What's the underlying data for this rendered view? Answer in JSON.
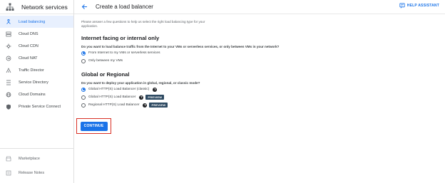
{
  "sidebar": {
    "title": "Network services",
    "items": [
      {
        "label": "Load balancing",
        "icon": "load-balancing-icon",
        "active": true
      },
      {
        "label": "Cloud DNS",
        "icon": "dns-icon"
      },
      {
        "label": "Cloud CDN",
        "icon": "cdn-icon"
      },
      {
        "label": "Cloud NAT",
        "icon": "nat-icon"
      },
      {
        "label": "Traffic Director",
        "icon": "traffic-director-icon"
      },
      {
        "label": "Service Directory",
        "icon": "service-directory-icon"
      },
      {
        "label": "Cloud Domains",
        "icon": "domains-icon"
      },
      {
        "label": "Private Service Connect",
        "icon": "shield-icon"
      }
    ],
    "bottom_items": [
      {
        "label": "Marketplace",
        "icon": "marketplace-icon"
      },
      {
        "label": "Release Notes",
        "icon": "release-notes-icon"
      }
    ]
  },
  "header": {
    "title": "Create a load balancer",
    "help_label": "HELP ASSISTANT"
  },
  "main": {
    "intro": "Please answer a few questions to help us select the right load balancing type for your application.",
    "section1": {
      "title": "Internet facing or internal only",
      "question": "Do you want to load balance traffic from the Internet to your VMs or serverless services, or only between VMs in your network?",
      "options": [
        {
          "label": "From Internet to my VMs or serverless services",
          "checked": true
        },
        {
          "label": "Only between my VMs",
          "checked": false
        }
      ]
    },
    "section2": {
      "title": "Global or Regional",
      "question": "Do you want to deploy your application in global, regional, or classic mode?",
      "options": [
        {
          "label": "Global HTTP(S) Load Balancer (classic)",
          "checked": true,
          "badge": null
        },
        {
          "label": "Global HTTP(S) Load Balancer",
          "checked": false,
          "badge": "PREVIEW"
        },
        {
          "label": "Regional HTTP(S) Load Balancer",
          "checked": false,
          "badge": "PREVIEW"
        }
      ],
      "help_glyph": "?"
    },
    "continue_label": "CONTINUE"
  },
  "colors": {
    "accent": "#1a73e8",
    "highlight_border": "#d93025",
    "badge_bg": "#2e4a62"
  }
}
